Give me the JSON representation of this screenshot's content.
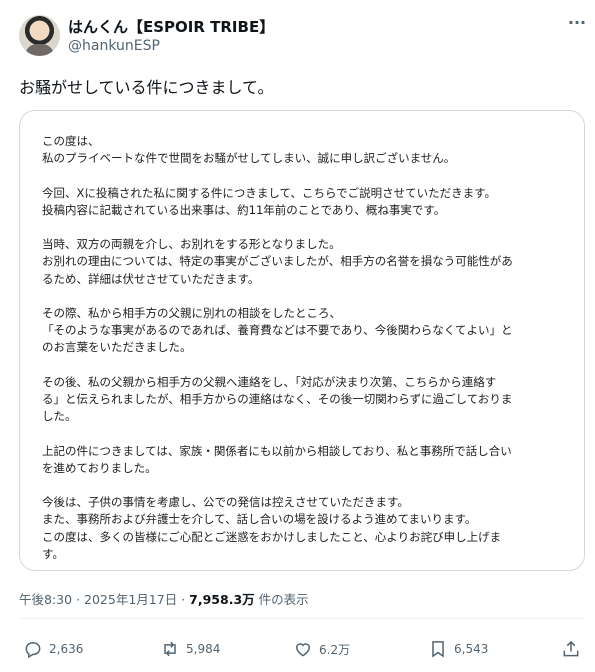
{
  "author": {
    "display_name": "はんくん【ESPOIR TRIBE】",
    "handle": "@hankunESP"
  },
  "more_button": "···",
  "tweet_text": "お騒がせしている件につきまして。",
  "statement": {
    "paragraphs": [
      [
        "この度は、",
        "私のプライベートな件で世間をお騒がせしてしまい、誠に申し訳ございません。"
      ],
      [
        "今回、Xに投稿された私に関する件につきまして、こちらでご説明させていただきます。",
        "投稿内容に記載されている出来事は、約11年前のことであり、概ね事実です。"
      ],
      [
        "当時、双方の両親を介し、お別れをする形となりました。",
        "お別れの理由については、特定の事実がございましたが、相手方の名誉を損なう可能性があ",
        "るため、詳細は伏せさせていただきます。"
      ],
      [
        "その際、私から相手方の父親に別れの相談をしたところ、",
        "「そのような事実があるのであれば、養育費などは不要であり、今後関わらなくてよい」と",
        "のお言葉をいただきました。"
      ],
      [
        "その後、私の父親から相手方の父親へ連絡をし、「対応が決まり次第、こちらから連絡す",
        "る」と伝えられましたが、相手方からの連絡はなく、その後一切関わらずに過ごしておりま",
        "した。"
      ],
      [
        "上記の件につきましては、家族・関係者にも以前から相談しており、私と事務所で話し合い",
        "を進めておりました。"
      ],
      [
        "今後は、子供の事情を考慮し、公での発信は控えさせていただきます。",
        "また、事務所および弁護士を介して、話し合いの場を設けるよう進めてまいります。",
        "この度は、多くの皆様にご心配とご迷惑をおかけしましたこと、心よりお詫び申し上げま",
        "す。"
      ]
    ]
  },
  "meta": {
    "time": "午後8:30",
    "separator": "·",
    "date": "2025年1月17日",
    "views_count": "7,958.3万",
    "views_label": "件の表示"
  },
  "actions": {
    "replies": "2,636",
    "reposts": "5,984",
    "likes": "6.2万",
    "bookmarks": "6,543"
  },
  "icons": [
    "reply-icon",
    "repost-icon",
    "like-icon",
    "bookmark-icon",
    "share-icon"
  ],
  "colors": {
    "text": "#0f1419",
    "secondary": "#536471",
    "border": "#cfd9de"
  }
}
